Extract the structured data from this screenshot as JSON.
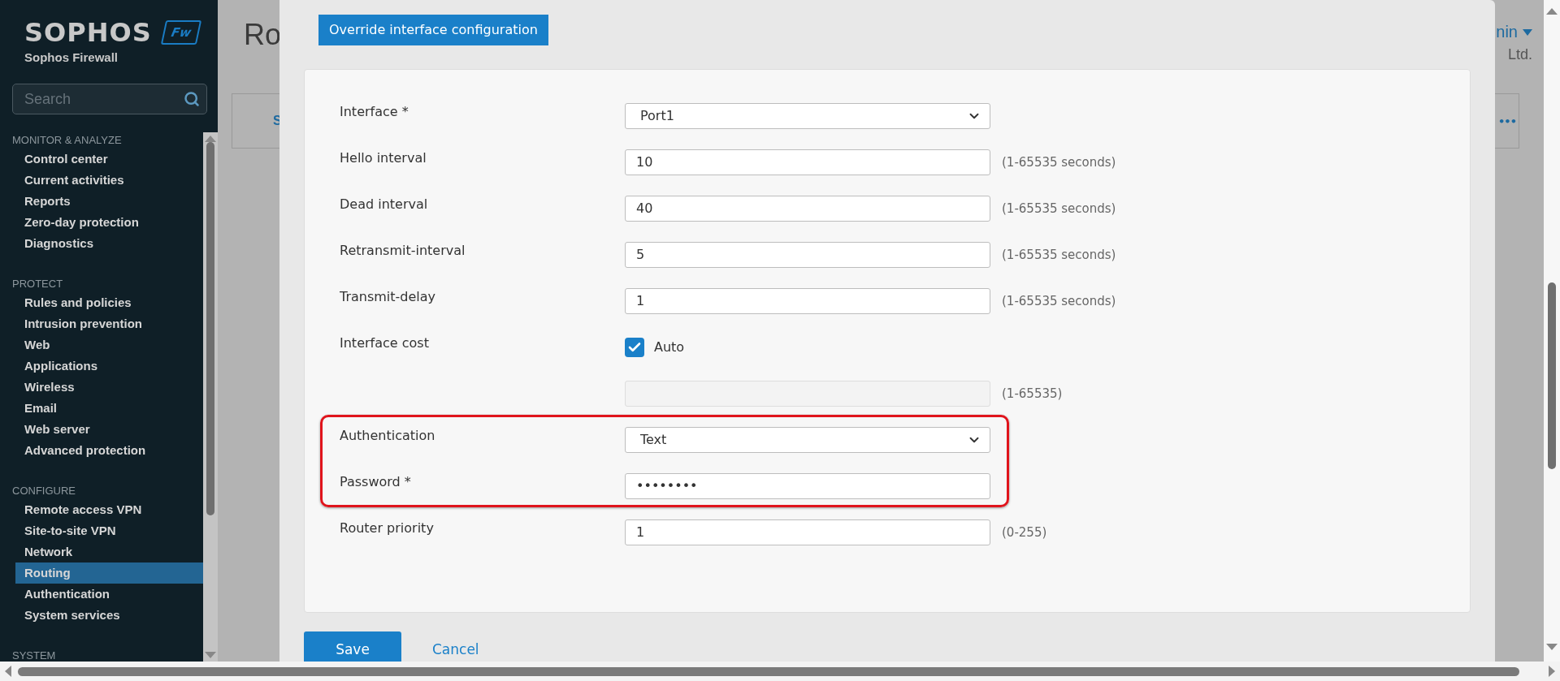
{
  "sidebar": {
    "logo": "SOPHOS",
    "badge": "Fw",
    "product": "Sophos Firewall",
    "search": {
      "placeholder": "Search"
    },
    "sections": [
      {
        "title": "MONITOR & ANALYZE",
        "items": [
          {
            "label": "Control center",
            "selected": false
          },
          {
            "label": "Current activities",
            "selected": false
          },
          {
            "label": "Reports",
            "selected": false
          },
          {
            "label": "Zero-day protection",
            "selected": false
          },
          {
            "label": "Diagnostics",
            "selected": false
          }
        ]
      },
      {
        "title": "PROTECT",
        "items": [
          {
            "label": "Rules and policies",
            "selected": false
          },
          {
            "label": "Intrusion prevention",
            "selected": false
          },
          {
            "label": "Web",
            "selected": false
          },
          {
            "label": "Applications",
            "selected": false
          },
          {
            "label": "Wireless",
            "selected": false
          },
          {
            "label": "Email",
            "selected": false
          },
          {
            "label": "Web server",
            "selected": false
          },
          {
            "label": "Advanced protection",
            "selected": false
          }
        ]
      },
      {
        "title": "CONFIGURE",
        "items": [
          {
            "label": "Remote access VPN",
            "selected": false
          },
          {
            "label": "Site-to-site VPN",
            "selected": false
          },
          {
            "label": "Network",
            "selected": false
          },
          {
            "label": "Routing",
            "selected": true
          },
          {
            "label": "Authentication",
            "selected": false
          },
          {
            "label": "System services",
            "selected": false
          }
        ]
      },
      {
        "title": "SYSTEM"
      }
    ]
  },
  "background": {
    "title": "Ro",
    "tab": "S",
    "user": "nin",
    "company": "Ltd.",
    "more": "•••"
  },
  "dialog": {
    "title": "Override interface configuration",
    "fields": [
      {
        "kind": "select",
        "label": "Interface *",
        "value": "Port1",
        "highlighted": false
      },
      {
        "kind": "text",
        "label": "Hello interval",
        "value": "10",
        "hint": "(1-65535 seconds)",
        "highlighted": false
      },
      {
        "kind": "text",
        "label": "Dead interval",
        "value": "40",
        "hint": "(1-65535 seconds)",
        "highlighted": false
      },
      {
        "kind": "text",
        "label": "Retransmit-interval",
        "value": "5",
        "hint": "(1-65535 seconds)",
        "highlighted": false
      },
      {
        "kind": "text",
        "label": "Transmit-delay",
        "value": "1",
        "hint": "(1-65535 seconds)",
        "highlighted": false
      },
      {
        "kind": "checkbox",
        "label": "Interface cost",
        "option": "Auto",
        "checked": true,
        "highlighted": false
      },
      {
        "kind": "text",
        "disabled": true,
        "hint": "(1-65535)",
        "highlighted": false
      },
      {
        "kind": "select",
        "label": "Authentication",
        "value": "Text",
        "highlighted": true
      },
      {
        "kind": "text",
        "label": "Password *",
        "value": "••••••••",
        "highlighted": true
      },
      {
        "kind": "text",
        "label": "Router priority",
        "value": "1",
        "hint": "(0-255)",
        "highlighted": false
      }
    ],
    "buttons": [
      {
        "kind": "primary",
        "label": "Save"
      },
      {
        "kind": "link",
        "label": "Cancel"
      }
    ]
  }
}
